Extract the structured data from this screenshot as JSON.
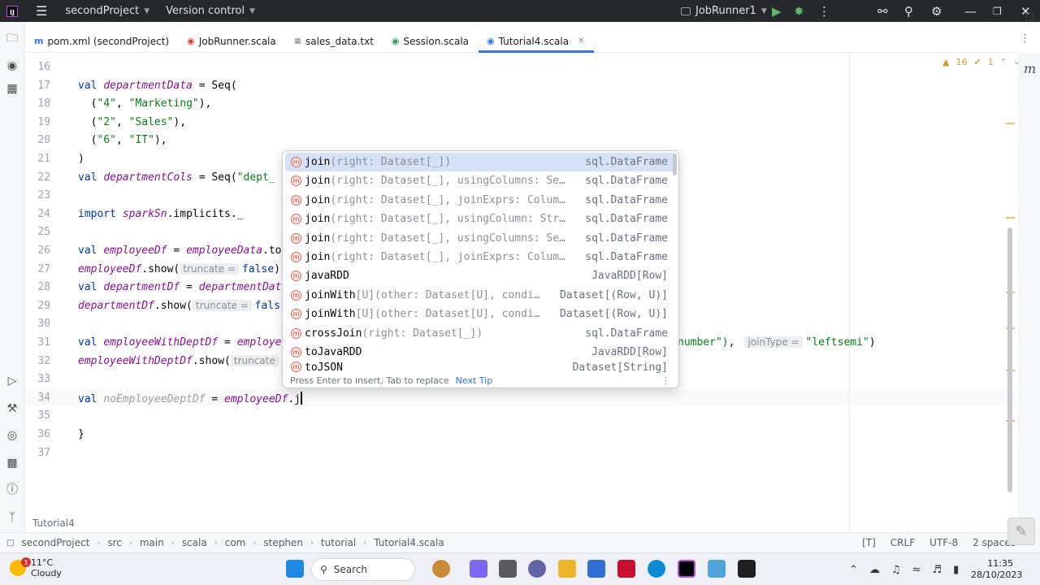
{
  "titlebar": {
    "project": "secondProject",
    "vcs": "Version control",
    "run_config": "JobRunner1"
  },
  "tabs": [
    {
      "label": "pom.xml (secondProject)",
      "icon": "m-file-icon",
      "color": "#3574f0"
    },
    {
      "label": "JobRunner.scala",
      "icon": "scala-file-icon",
      "color": "#d5443a"
    },
    {
      "label": "sales_data.txt",
      "icon": "text-file-icon",
      "color": "#6c707e"
    },
    {
      "label": "Session.scala",
      "icon": "scala-object-icon",
      "color": "#2b9a5e"
    },
    {
      "label": "Tutorial4.scala",
      "icon": "scala-class-icon",
      "color": "#3574f0",
      "active": true
    }
  ],
  "editor": {
    "inspections": {
      "warnings": "16",
      "weak_warnings": "1"
    },
    "lines": [
      {
        "n": "16",
        "tokens": []
      },
      {
        "n": "17",
        "tokens": [
          {
            "t": "val ",
            "c": "kw"
          },
          {
            "t": "departmentData",
            "c": "var"
          },
          {
            "t": " = Seq(",
            "c": ""
          }
        ]
      },
      {
        "n": "18",
        "tokens": [
          {
            "t": "  (",
            "c": ""
          },
          {
            "t": "\"4\"",
            "c": "str"
          },
          {
            "t": ", ",
            "c": ""
          },
          {
            "t": "\"Marketing\"",
            "c": "str"
          },
          {
            "t": "),",
            "c": ""
          }
        ]
      },
      {
        "n": "19",
        "tokens": [
          {
            "t": "  (",
            "c": ""
          },
          {
            "t": "\"2\"",
            "c": "str"
          },
          {
            "t": ", ",
            "c": ""
          },
          {
            "t": "\"Sales\"",
            "c": "str"
          },
          {
            "t": "),",
            "c": ""
          }
        ]
      },
      {
        "n": "20",
        "tokens": [
          {
            "t": "  (",
            "c": ""
          },
          {
            "t": "\"6\"",
            "c": "str"
          },
          {
            "t": ", ",
            "c": ""
          },
          {
            "t": "\"IT\"",
            "c": "str"
          },
          {
            "t": "),",
            "c": ""
          }
        ]
      },
      {
        "n": "21",
        "tokens": [
          {
            "t": ")",
            "c": ""
          }
        ]
      },
      {
        "n": "22",
        "tokens": [
          {
            "t": "val ",
            "c": "kw"
          },
          {
            "t": "departmentCols",
            "c": "var"
          },
          {
            "t": " = Seq(",
            "c": ""
          },
          {
            "t": "\"dept_",
            "c": "str"
          }
        ]
      },
      {
        "n": "23",
        "tokens": []
      },
      {
        "n": "24",
        "tokens": [
          {
            "t": "import ",
            "c": "kw"
          },
          {
            "t": "sparkSn",
            "c": "var"
          },
          {
            "t": ".implicits._",
            "c": ""
          }
        ]
      },
      {
        "n": "25",
        "tokens": []
      },
      {
        "n": "26",
        "tokens": [
          {
            "t": "val ",
            "c": "kw"
          },
          {
            "t": "employeeDf",
            "c": "var"
          },
          {
            "t": " = ",
            "c": ""
          },
          {
            "t": "employeeData",
            "c": "var"
          },
          {
            "t": ".to",
            "c": ""
          }
        ]
      },
      {
        "n": "27",
        "tokens": [
          {
            "t": "employeeDf",
            "c": "var"
          },
          {
            "t": ".show(",
            "c": ""
          },
          {
            "t": "truncate =",
            "c": "hint"
          },
          {
            "t": "false",
            "c": "kw"
          },
          {
            "t": ")",
            "c": ""
          }
        ]
      },
      {
        "n": "28",
        "tokens": [
          {
            "t": "val ",
            "c": "kw"
          },
          {
            "t": "departmentDf",
            "c": "var"
          },
          {
            "t": " = ",
            "c": ""
          },
          {
            "t": "departmentDat",
            "c": "var"
          }
        ]
      },
      {
        "n": "29",
        "tokens": [
          {
            "t": "departmentDf",
            "c": "var"
          },
          {
            "t": ".show(",
            "c": ""
          },
          {
            "t": "truncate =",
            "c": "hint"
          },
          {
            "t": "fals",
            "c": "kw"
          }
        ]
      },
      {
        "n": "30",
        "tokens": []
      },
      {
        "n": "31",
        "tokens": [
          {
            "t": "val ",
            "c": "kw"
          },
          {
            "t": "employeeWithDeptDf",
            "c": "var"
          },
          {
            "t": " = ",
            "c": ""
          },
          {
            "t": "employe",
            "c": "var"
          }
        ]
      },
      {
        "n": "32",
        "tokens": [
          {
            "t": "employeeWithDeptDf",
            "c": "var"
          },
          {
            "t": ".show(",
            "c": ""
          },
          {
            "t": "truncate",
            "c": "hint"
          }
        ]
      },
      {
        "n": "33",
        "tokens": []
      },
      {
        "n": "34",
        "tokens": [
          {
            "t": "val ",
            "c": "kw"
          },
          {
            "t": "noEmployeeDeptDf",
            "c": "dim"
          },
          {
            "t": " = ",
            "c": ""
          },
          {
            "t": "employeeDf",
            "c": "var"
          },
          {
            "t": ".j",
            "c": ""
          }
        ],
        "current": true
      },
      {
        "n": "35",
        "tokens": []
      },
      {
        "n": "36",
        "tokens": [
          {
            "t": "}",
            "c": ""
          }
        ]
      },
      {
        "n": "37",
        "tokens": []
      }
    ],
    "line31_tail": {
      "str_end": "number\")",
      "comma": ",",
      "hint": "joinType =",
      "value": "\"leftsemi\"",
      "close": ")"
    }
  },
  "completion": {
    "items": [
      {
        "name": "join",
        "sig": "(right: Dataset[_])",
        "rtype": "sql.DataFrame",
        "selected": true
      },
      {
        "name": "join",
        "sig": "(right: Dataset[_], usingColumns: Se…",
        "rtype": "sql.DataFrame"
      },
      {
        "name": "join",
        "sig": "(right: Dataset[_], joinExprs: Colum…",
        "rtype": "sql.DataFrame"
      },
      {
        "name": "join",
        "sig": "(right: Dataset[_], usingColumn: Str…",
        "rtype": "sql.DataFrame"
      },
      {
        "name": "join",
        "sig": "(right: Dataset[_], usingColumns: Se…",
        "rtype": "sql.DataFrame"
      },
      {
        "name": "join",
        "sig": "(right: Dataset[_], joinExprs: Colum…",
        "rtype": "sql.DataFrame"
      },
      {
        "name": "javaRDD",
        "sig": "",
        "rtype": "JavaRDD[Row]"
      },
      {
        "name": "joinWith",
        "sig": "[U](other: Dataset[U], condi…",
        "rtype": "Dataset[(Row, U)]"
      },
      {
        "name": "joinWith",
        "sig": "[U](other: Dataset[U], condi…",
        "rtype": "Dataset[(Row, U)]"
      },
      {
        "name": "crossJoin",
        "sig": "(right: Dataset[_])",
        "rtype": "sql.DataFrame"
      },
      {
        "name": "toJavaRDD",
        "sig": "",
        "rtype": "JavaRDD[Row]"
      },
      {
        "name": "toJSON",
        "sig": "",
        "rtype": "Dataset[String]"
      }
    ],
    "item_icon_letter": "m",
    "footer_text": "Press Enter to insert, Tab to replace",
    "footer_link": "Next Tip"
  },
  "editor_breadcrumb": "Tutorial4",
  "statusbar": {
    "crumbs": [
      "secondProject",
      "src",
      "main",
      "scala",
      "com",
      "stephen",
      "tutorial",
      "Tutorial4.scala"
    ],
    "right": [
      "[T]",
      "CRLF",
      "UTF-8",
      "2 spaces"
    ]
  },
  "taskbar": {
    "weather_temp": "11°C",
    "weather_desc": "Cloudy",
    "notification_count": "1",
    "search_label": "Search",
    "time": "11:35",
    "date": "28/10/2023"
  }
}
